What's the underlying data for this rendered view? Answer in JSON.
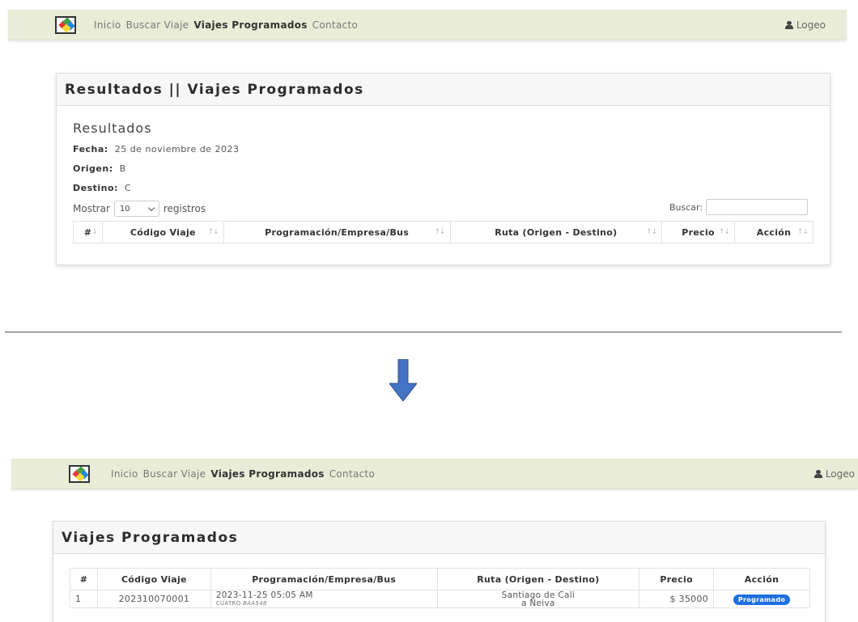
{
  "nav": {
    "items": [
      {
        "label": "Inicio",
        "active": false
      },
      {
        "label": "Buscar Viaje",
        "active": false
      },
      {
        "label": "Viajes Programados",
        "active": true
      },
      {
        "label": "Contacto",
        "active": false
      }
    ],
    "login_label": "Logeo",
    "bg_color": "#e9edd8"
  },
  "before": {
    "card_title": "Resultados || Viajes Programados",
    "section_title": "Resultados",
    "fecha_label": "Fecha:",
    "fecha_value": "25 de noviembre de 2023",
    "origen_label": "Origen:",
    "origen_value": "B",
    "destino_label": "Destino:",
    "destino_value": "C",
    "mostrar_label": "Mostrar",
    "select_value": "10",
    "registros_label": "registros",
    "buscar_label": "Buscar:",
    "columns": [
      "#",
      "Código Viaje",
      "Programación/Empresa/Bus",
      "Ruta (Origen - Destino)",
      "Precio",
      "Acción"
    ]
  },
  "after": {
    "card_title": "Viajes Programados",
    "columns": [
      "#",
      "Código Viaje",
      "Programación/Empresa/Bus",
      "Ruta (Origen - Destino)",
      "Precio",
      "Acción"
    ],
    "row": {
      "num": "1",
      "code": "202310070001",
      "datetime": "2023-11-25 05:05 AM",
      "company": "CUATRO",
      "bus": "BAA548",
      "route_origin": "Santiago de Cali",
      "route_dest": "a Neiva",
      "price": "$ 35000",
      "status": "Programado"
    }
  },
  "colors": {
    "arrow": "#4472c4",
    "badge": "#1d6fe0"
  }
}
